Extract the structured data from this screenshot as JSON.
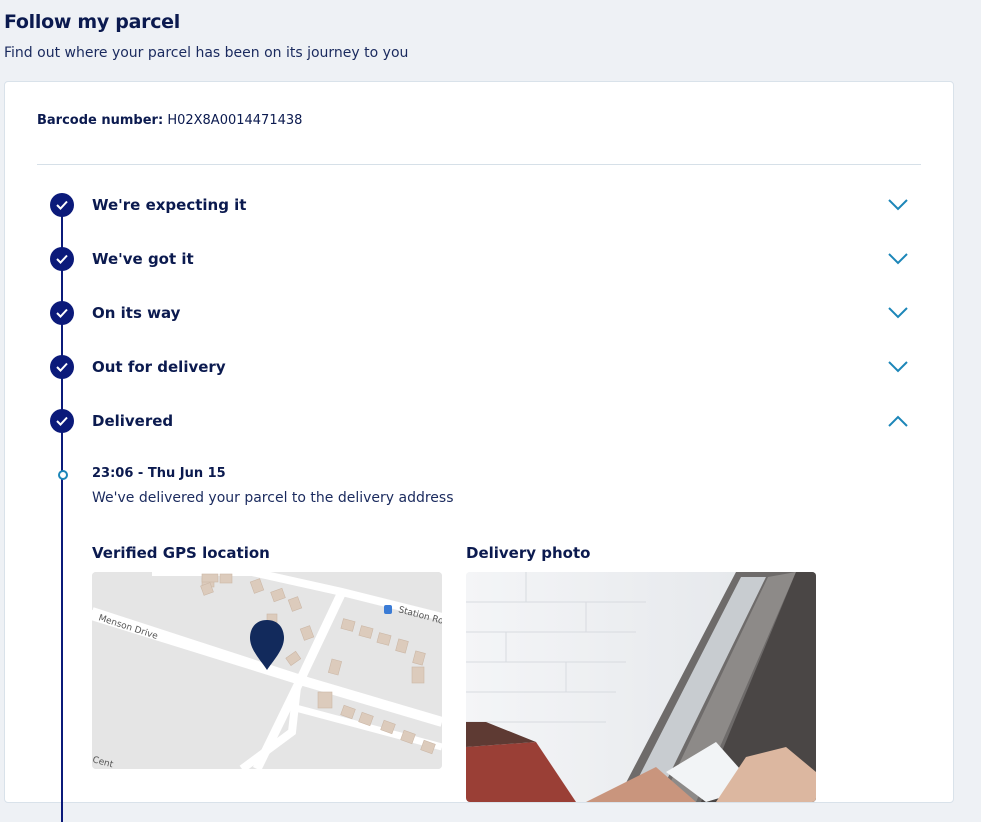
{
  "header": {
    "title": "Follow my parcel",
    "subtitle": "Find out where your parcel has been on its journey to you"
  },
  "barcode": {
    "label": "Barcode number:",
    "value": "H02X8A0014471438"
  },
  "steps": [
    {
      "label": "We're expecting it",
      "completed": true,
      "expanded": false,
      "icon": "chevron-down-icon"
    },
    {
      "label": "We've got it",
      "completed": true,
      "expanded": false,
      "icon": "chevron-down-icon"
    },
    {
      "label": "On its way",
      "completed": true,
      "expanded": false,
      "icon": "chevron-down-icon"
    },
    {
      "label": "Out for delivery",
      "completed": true,
      "expanded": false,
      "icon": "chevron-down-icon"
    },
    {
      "label": "Delivered",
      "completed": true,
      "expanded": true,
      "icon": "chevron-up-icon"
    }
  ],
  "delivered_event": {
    "time": "23:06 - Thu Jun 15",
    "description": "We've delivered your parcel to the delivery address"
  },
  "gps": {
    "heading": "Verified GPS location",
    "street_labels": [
      "Menson Drive",
      "Station Ro",
      "Cent"
    ]
  },
  "photo": {
    "heading": "Delivery photo"
  },
  "colors": {
    "navy": "#0b1a7a",
    "accent_blue": "#1c86b8",
    "background": "#eef1f5"
  }
}
